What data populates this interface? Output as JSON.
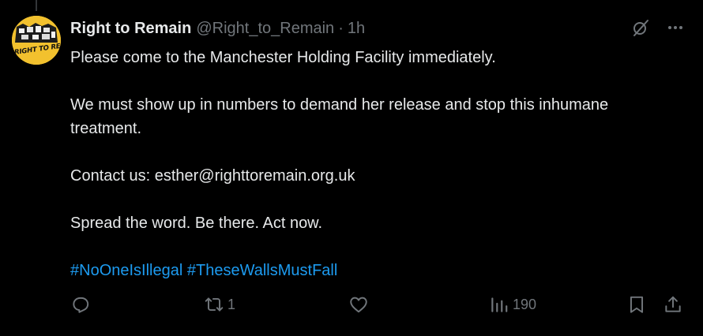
{
  "author": {
    "display_name": "Right to Remain",
    "handle": "@Right_to_Remain",
    "separator": "·",
    "time": "1h",
    "avatar_text": "RIGHT TO REMAIN"
  },
  "tweet": {
    "paragraphs": [
      "Please come to the Manchester Holding Facility immediately.",
      "We must show up in numbers to demand her release and stop this inhumane treatment.",
      "Contact us: esther@righttoremain.org.uk",
      "Spread the word. Be there. Act now."
    ],
    "hashtags": [
      "#NoOneIsIllegal",
      "#TheseWallsMustFall"
    ]
  },
  "actions": {
    "reply_count": "",
    "retweet_count": "1",
    "like_count": "",
    "views_count": "190"
  },
  "icons": {
    "grok": "grok-icon",
    "more": "more-icon",
    "reply": "reply-icon",
    "retweet": "retweet-icon",
    "like": "heart-icon",
    "views": "views-icon",
    "bookmark": "bookmark-icon",
    "share": "share-icon"
  },
  "colors": {
    "background": "#000000",
    "text": "#e7e9ea",
    "muted": "#71767b",
    "link": "#1d9bf0",
    "avatar_bg": "#f2c12e"
  }
}
